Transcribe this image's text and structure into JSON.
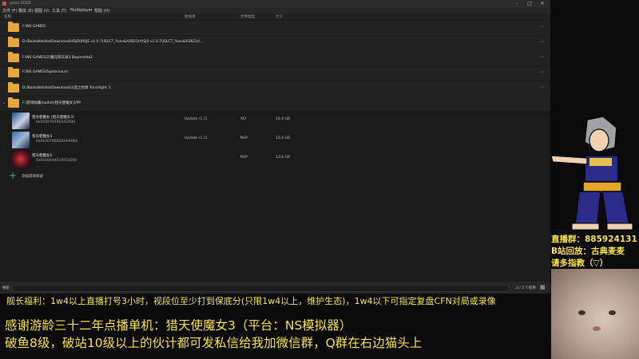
{
  "window": {
    "title": "yuzu 1018"
  },
  "menu": [
    {
      "label": "文件 (F)"
    },
    {
      "label": "模拟 (E)"
    },
    {
      "label": "视图 (V)"
    },
    {
      "label": "工具 (T)"
    },
    {
      "label": "Multiplayer"
    },
    {
      "label": "帮助 (H)"
    }
  ],
  "columns": {
    "name": "名称",
    "addons": "附加项",
    "filetype": "文件类型",
    "size": "大小"
  },
  "dirs": [
    {
      "path": "F:/NS GAMES"
    },
    {
      "path": "D:/BaiduNetdiskDownload/HSJSUHSJS v1.0.7(ISLCT_Yuzu&A2823)/HSJS v1.0.7(ISLCT_Yuzu&A2823)/..."
    },
    {
      "path": "F:/NS GAMES/2/魔兵惊天录3 Bayonetta2"
    },
    {
      "path": "F:/NS GAMES/Spidersaurs"
    },
    {
      "path": "D:/BaiduNetdiskDownload/火焰之纹章 Torchlight 3"
    },
    {
      "path": "F:/游戏收藏/switch/猎天使魔女3/PP"
    }
  ],
  "games": [
    {
      "name": "猎天使魔女 (猎天使魔女3)",
      "id": "0x01007970EAA2000",
      "update": "Update (1.1)",
      "format": "XCI",
      "size": "14.9 GB"
    },
    {
      "name": "猎天使魔女3",
      "id": "0x01007900DA0A9000",
      "update": "Update (1.1)",
      "format": "NSP",
      "size": "12.4 GB"
    },
    {
      "name": "猎天使魔女2",
      "id": "0x01004A4010FE4000",
      "update": "",
      "format": "NSP",
      "size": "13.8 GB"
    }
  ],
  "add_dir": {
    "label": "添加游戏目录"
  },
  "status": {
    "filter_label": "搜索",
    "count": "3 / 3 个结果"
  },
  "overlay": {
    "banner": "舰长福利：1w4以上直播打号3小时，视段位至少打到保底分(只限1w4以上，维护生态)，1w4以下可指定复盘CFN对局或录像",
    "thanks": "感谢游龄三十二年点播单机：猎天使魔女3（平台：NS模拟器）",
    "line2": "破鱼8级，破站10级以上的伙计都可发私信给我加微信群，Q群在右边猫头上",
    "live_group": "直播群：885924131",
    "replay": "B站回放：古典麦麦",
    "likes": "请多指教（▽）"
  },
  "colors": {
    "folder": "#e9a73a",
    "accent": "#2fb3a4",
    "overlay_text": "#ffe64d"
  },
  "icons": [
    "folder-icon",
    "plus-icon",
    "grid-icon",
    "app-icon"
  ]
}
